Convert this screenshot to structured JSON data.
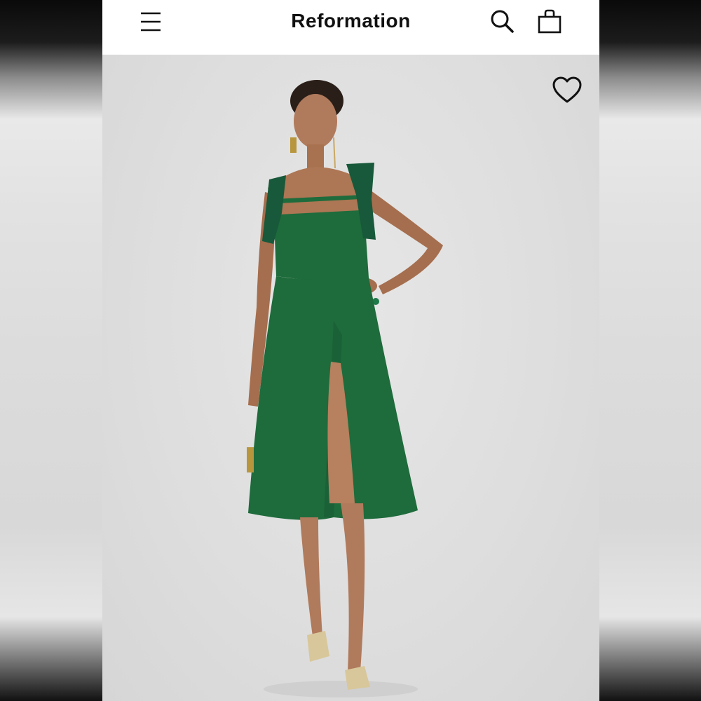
{
  "header": {
    "brand": "Reformation",
    "menu_icon": "hamburger-menu-icon",
    "search_icon": "search-icon",
    "bag_icon": "shopping-bag-icon"
  },
  "product_image": {
    "favorite_icon": "heart-outline-icon",
    "dress_color": "#1e6b3c"
  }
}
